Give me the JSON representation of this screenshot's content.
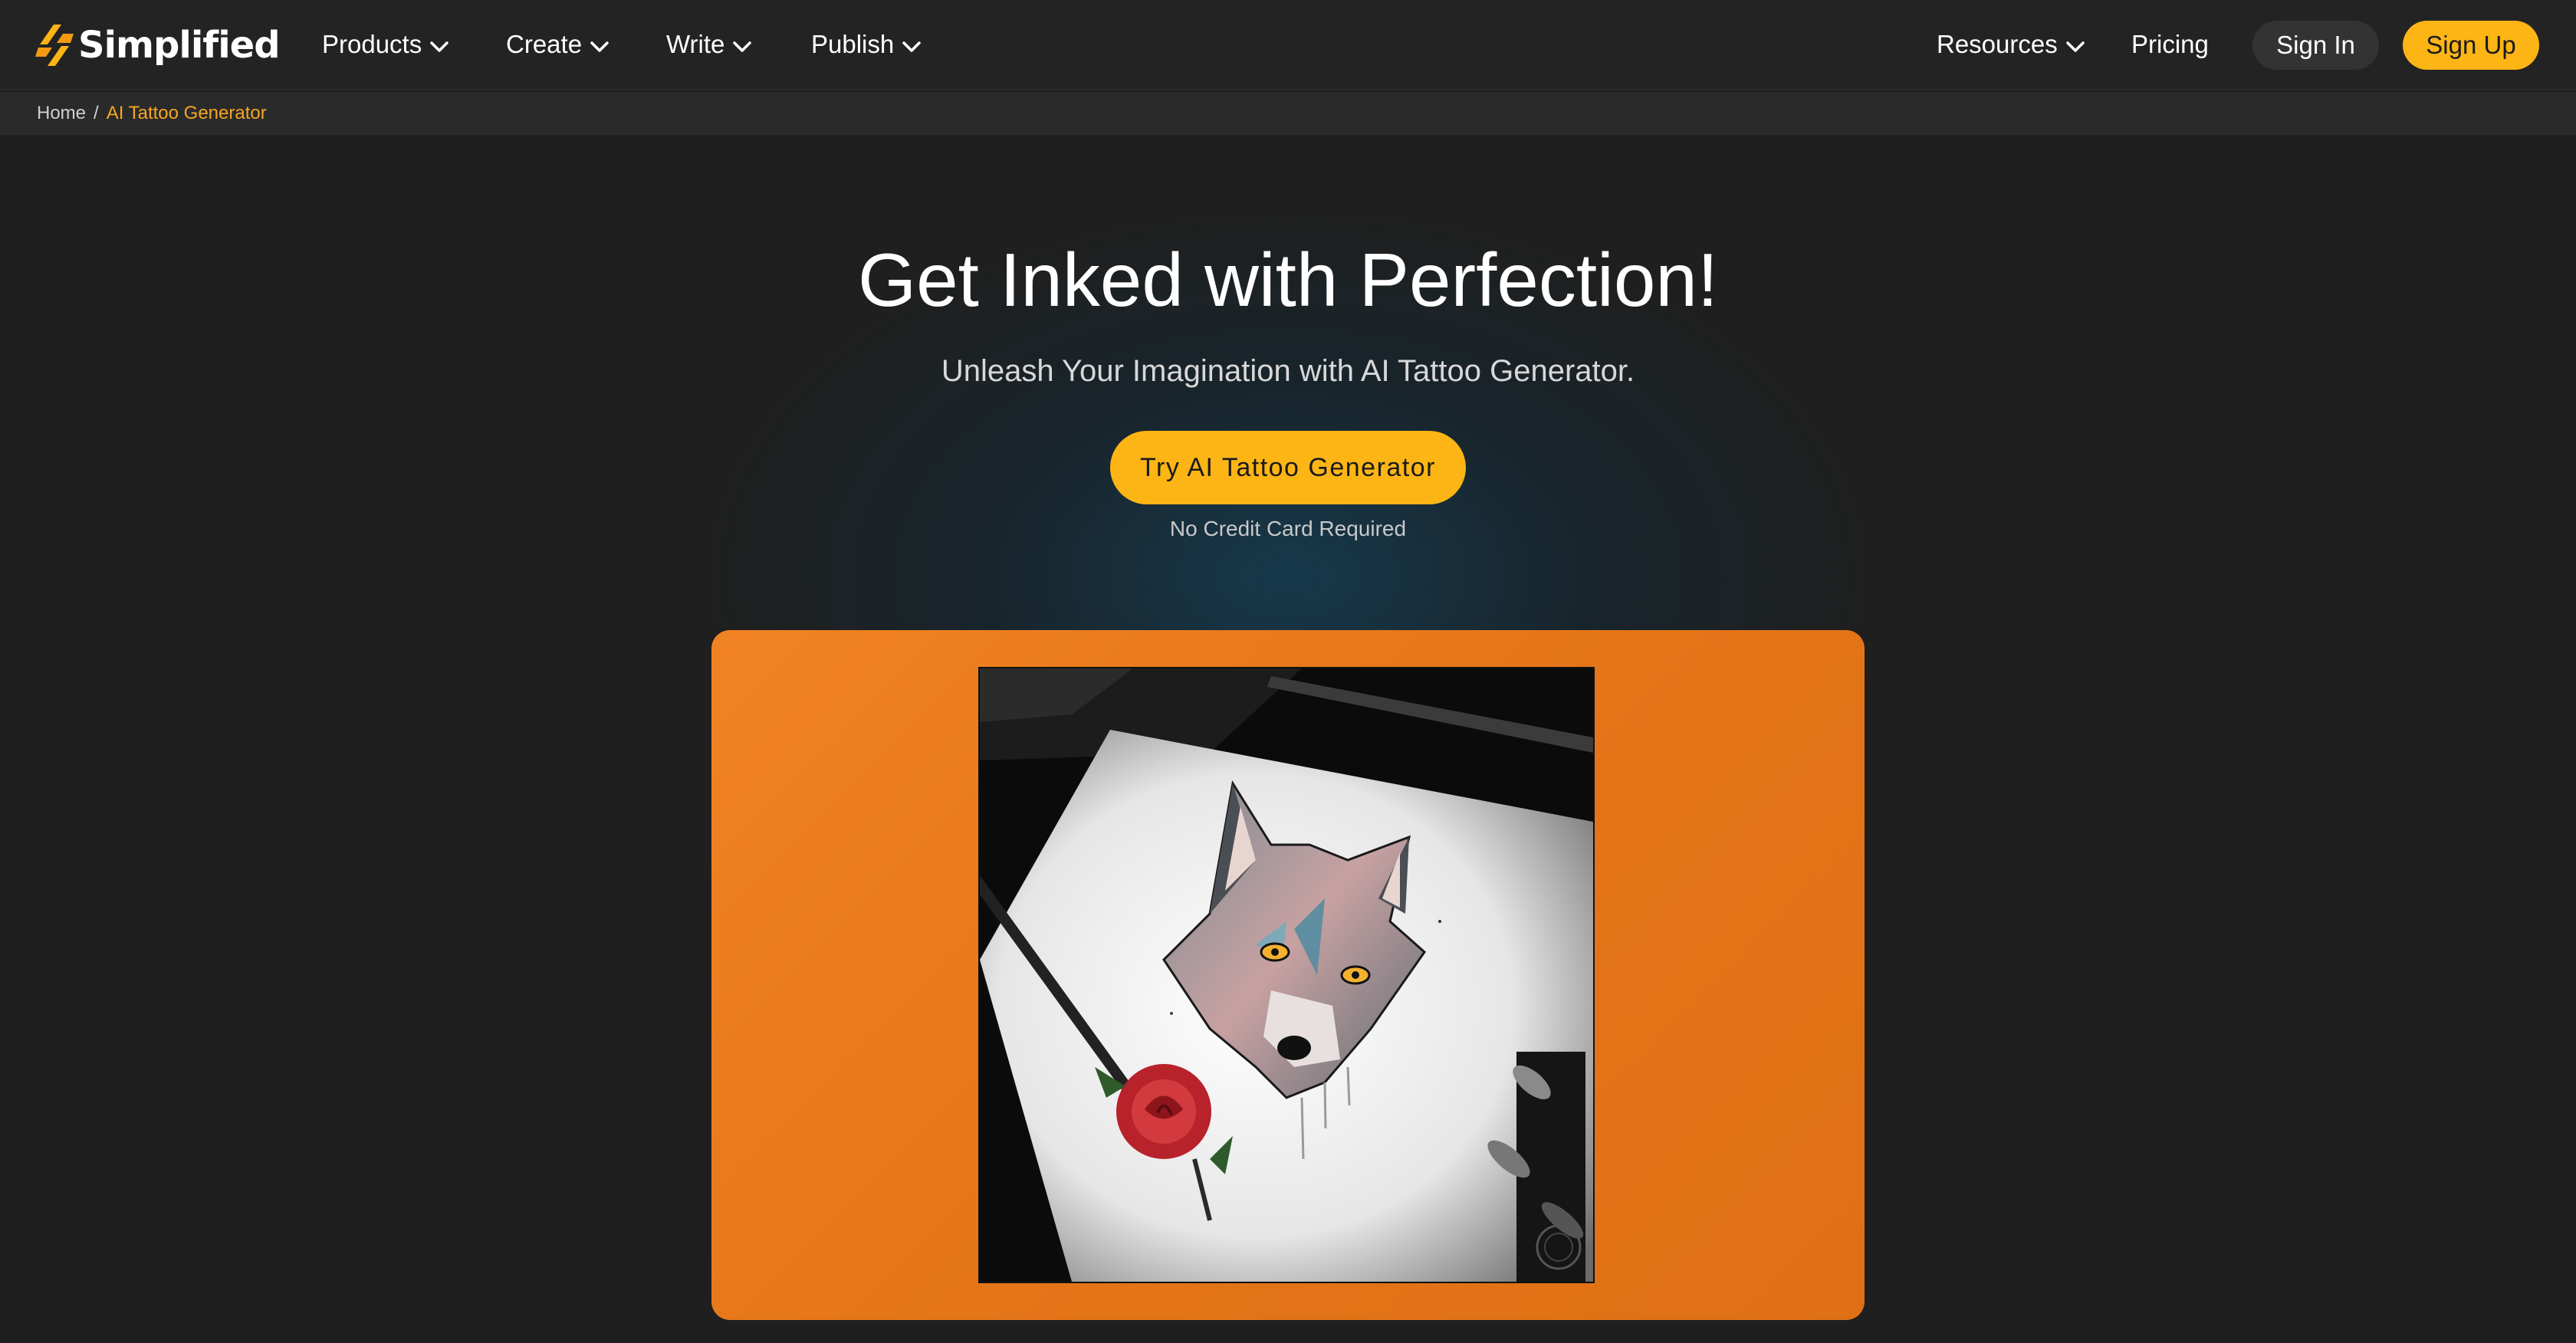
{
  "brand": {
    "name": "Simplified",
    "icon": "simplified-logo-icon"
  },
  "nav": {
    "items": [
      {
        "label": "Products",
        "has_dropdown": true
      },
      {
        "label": "Create",
        "has_dropdown": true
      },
      {
        "label": "Write",
        "has_dropdown": true
      },
      {
        "label": "Publish",
        "has_dropdown": true
      }
    ],
    "right_items": [
      {
        "label": "Resources",
        "has_dropdown": true
      },
      {
        "label": "Pricing",
        "has_dropdown": false
      }
    ],
    "sign_in": "Sign In",
    "sign_up": "Sign Up"
  },
  "breadcrumb": {
    "home": "Home",
    "separator": "/",
    "current": "AI Tattoo Generator"
  },
  "hero": {
    "title": "Get Inked with Perfection!",
    "subtitle": "Unleash Your Imagination with AI Tattoo Generator.",
    "cta": "Try AI Tattoo Generator",
    "cta_note": "No Credit Card Required"
  },
  "showcase": {
    "image": "wolf-and-rose-tattoo-sketch"
  },
  "colors": {
    "accent": "#fdb515",
    "background": "#1f1f1f",
    "nav_bg": "#232323",
    "showcase_bg": "#e47519",
    "breadcrumb_current": "#f5a623"
  }
}
